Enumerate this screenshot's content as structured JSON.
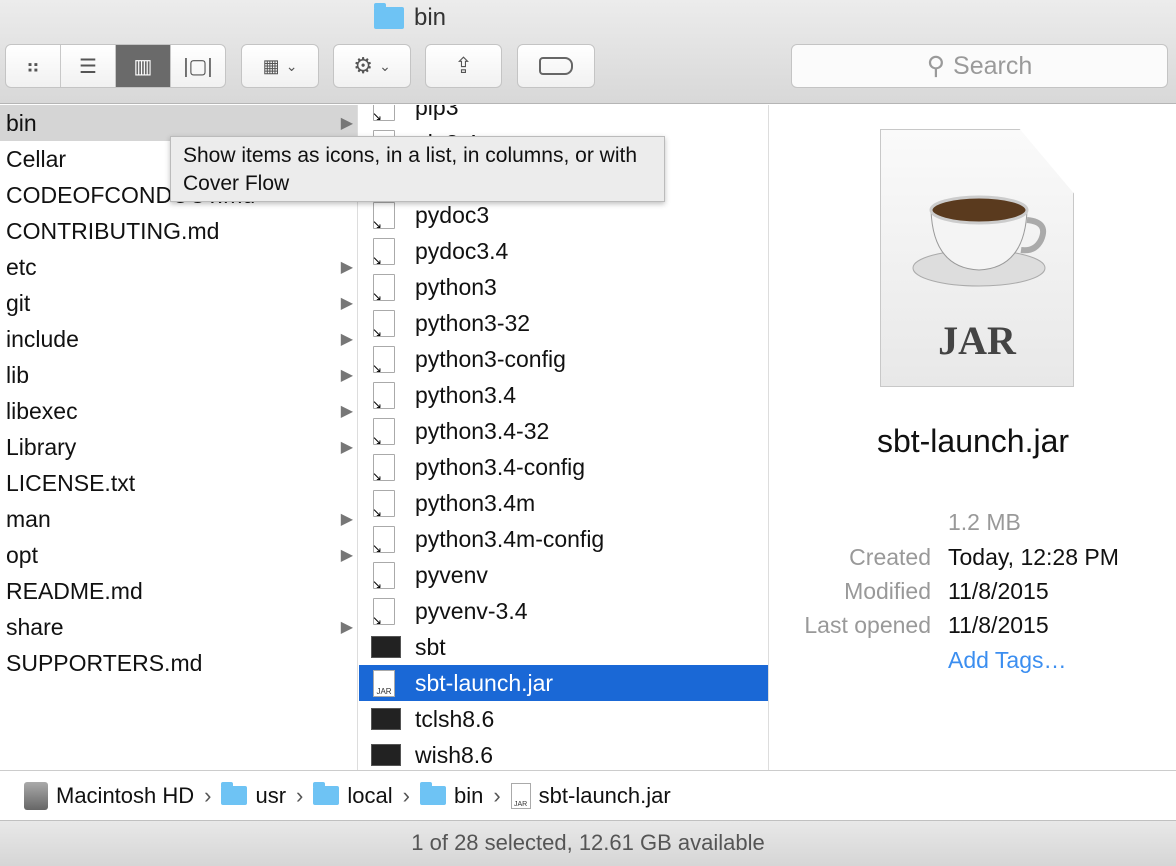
{
  "window": {
    "title": "bin"
  },
  "toolbar": {
    "view_modes": [
      {
        "name": "icon-view",
        "glyph": "⠶"
      },
      {
        "name": "list-view",
        "glyph": "☰"
      },
      {
        "name": "column-view",
        "glyph": "▥"
      },
      {
        "name": "cover-flow-view",
        "glyph": "▯"
      }
    ],
    "active_view": "column-view",
    "search_placeholder": "Search"
  },
  "tooltip": "Show items as icons, in a list, in columns, or with Cover Flow",
  "column1": [
    {
      "label": "bin",
      "folder": true,
      "selected": true
    },
    {
      "label": "Cellar",
      "folder": false
    },
    {
      "label": "CODEOFCONDUCT.md",
      "folder": false
    },
    {
      "label": "CONTRIBUTING.md",
      "folder": false
    },
    {
      "label": "etc",
      "folder": true
    },
    {
      "label": "git",
      "folder": true
    },
    {
      "label": "include",
      "folder": true
    },
    {
      "label": "lib",
      "folder": true
    },
    {
      "label": "libexec",
      "folder": true
    },
    {
      "label": "Library",
      "folder": true
    },
    {
      "label": "LICENSE.txt",
      "folder": false
    },
    {
      "label": "man",
      "folder": true
    },
    {
      "label": "opt",
      "folder": true
    },
    {
      "label": "README.md",
      "folder": false
    },
    {
      "label": "share",
      "folder": true
    },
    {
      "label": "SUPPORTERS.md",
      "folder": false
    }
  ],
  "column2": [
    {
      "label": "pip3",
      "icon": "alias"
    },
    {
      "label": "pip3.4",
      "icon": "alias"
    },
    {
      "label": "",
      "icon": "alias"
    },
    {
      "label": "pydoc3",
      "icon": "alias"
    },
    {
      "label": "pydoc3.4",
      "icon": "alias"
    },
    {
      "label": "python3",
      "icon": "alias"
    },
    {
      "label": "python3-32",
      "icon": "alias"
    },
    {
      "label": "python3-config",
      "icon": "alias"
    },
    {
      "label": "python3.4",
      "icon": "alias"
    },
    {
      "label": "python3.4-32",
      "icon": "alias"
    },
    {
      "label": "python3.4-config",
      "icon": "alias"
    },
    {
      "label": "python3.4m",
      "icon": "alias"
    },
    {
      "label": "python3.4m-config",
      "icon": "alias"
    },
    {
      "label": "pyvenv",
      "icon": "alias"
    },
    {
      "label": "pyvenv-3.4",
      "icon": "alias"
    },
    {
      "label": "sbt",
      "icon": "terminal"
    },
    {
      "label": "sbt-launch.jar",
      "icon": "jar",
      "selected": true
    },
    {
      "label": "tclsh8.6",
      "icon": "terminal"
    },
    {
      "label": "wish8.6",
      "icon": "terminal"
    }
  ],
  "preview": {
    "icon_label": "JAR",
    "name": "sbt-launch.jar",
    "size": "1.2 MB",
    "created_label": "Created",
    "created": "Today, 12:28 PM",
    "modified_label": "Modified",
    "modified": "11/8/2015",
    "opened_label": "Last opened",
    "opened": "11/8/2015",
    "add_tags": "Add Tags…"
  },
  "path": [
    {
      "label": "Macintosh HD",
      "icon": "disk"
    },
    {
      "label": "usr",
      "icon": "folder"
    },
    {
      "label": "local",
      "icon": "folder"
    },
    {
      "label": "bin",
      "icon": "folder"
    },
    {
      "label": "sbt-launch.jar",
      "icon": "jar"
    }
  ],
  "status": "1 of 28 selected, 12.61 GB available",
  "colors": {
    "selection": "#1a68d6",
    "link": "#3b8ef0",
    "folder": "#6ec3f4"
  }
}
